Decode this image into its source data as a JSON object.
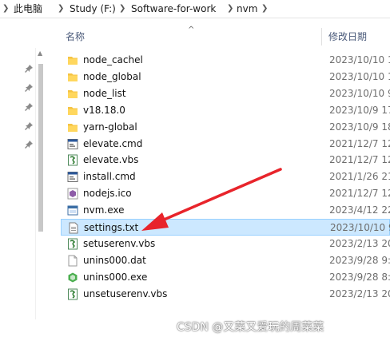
{
  "breadcrumb": {
    "items": [
      "此电脑",
      "Study (F:)",
      "Software-for-work",
      "nvm"
    ]
  },
  "columns": {
    "name": "名称",
    "date": "修改日期"
  },
  "files": [
    {
      "name": "node_cachel",
      "date": "2023/10/10 1",
      "icon": "folder-icon",
      "selected": false
    },
    {
      "name": "node_global",
      "date": "2023/10/10 1",
      "icon": "folder-icon",
      "selected": false
    },
    {
      "name": "node_list",
      "date": "2023/10/10 9",
      "icon": "folder-icon",
      "selected": false
    },
    {
      "name": "v18.18.0",
      "date": "2023/10/9 17",
      "icon": "folder-icon",
      "selected": false
    },
    {
      "name": "yarn-global",
      "date": "2023/10/9 18",
      "icon": "folder-icon",
      "selected": false
    },
    {
      "name": "elevate.cmd",
      "date": "2021/12/7 12",
      "icon": "cmd-file-icon",
      "selected": false
    },
    {
      "name": "elevate.vbs",
      "date": "2021/12/7 12",
      "icon": "vbs-script-icon",
      "selected": false
    },
    {
      "name": "install.cmd",
      "date": "2021/1/26 21",
      "icon": "cmd-file-icon",
      "selected": false
    },
    {
      "name": "nodejs.ico",
      "date": "2021/12/7 12",
      "icon": "ico-file-icon",
      "selected": false
    },
    {
      "name": "nvm.exe",
      "date": "2023/4/12 22",
      "icon": "exe-app-icon",
      "selected": false
    },
    {
      "name": "settings.txt",
      "date": "2023/10/10 9",
      "icon": "text-file-icon",
      "selected": true
    },
    {
      "name": "setuserenv.vbs",
      "date": "2023/2/13 20",
      "icon": "vbs-script-icon",
      "selected": false
    },
    {
      "name": "unins000.dat",
      "date": "2023/9/28 9:",
      "icon": "dat-file-icon",
      "selected": false
    },
    {
      "name": "unins000.exe",
      "date": "2023/9/28 8:",
      "icon": "installer-exe-icon",
      "selected": false
    },
    {
      "name": "unsetuserenv.vbs",
      "date": "2023/2/13 20",
      "icon": "vbs-script-icon",
      "selected": false
    }
  ],
  "watermark": "CSDN @又菜又爱玩的周菜菜",
  "colors": {
    "selection_bg": "#cce8ff",
    "selection_border": "#99d1ff",
    "annotation_arrow": "#e8242b",
    "folder": "#f5c342"
  }
}
